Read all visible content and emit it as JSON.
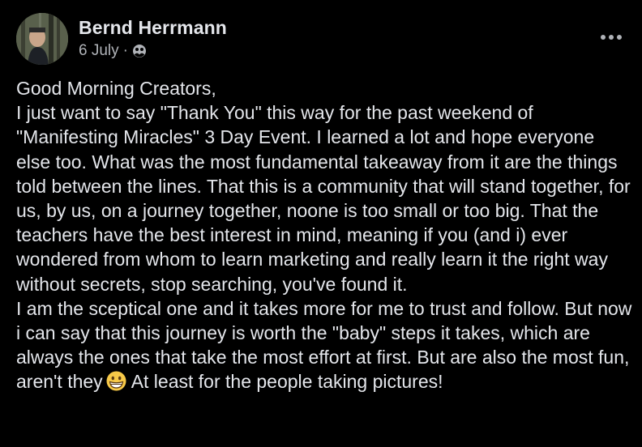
{
  "post": {
    "author_name": "Bernd Herrmann",
    "date": "6 July",
    "separator": "·",
    "privacy_icon": "friends-globe-icon",
    "more_icon": "ellipsis-icon",
    "body_before_emoji": "Good Morning Creators,\nI just want to say \"Thank You\" this way for the past weekend of \"Manifesting Miracles\" 3 Day Event. I learned a lot and hope everyone else too. What was the most fundamental takeaway from it are the things told between the lines. That this is a community that will stand together, for us, by us, on a journey together, noone is too small or too big. That the teachers have the best interest in mind, meaning if you (and i) ever wondered from whom to learn marketing and really learn it the right way without secrets, stop searching, you've found it.\nI am the sceptical one and it takes more for me to trust and follow. But now i can say that this journey is worth the \"baby\" steps it takes, which are always the ones that take the most effort at first. But are also the most fun, aren't they",
    "emoji": "grinning-face-emoji",
    "body_after_emoji": "At least for the people taking pictures!"
  },
  "colors": {
    "background": "#000000",
    "text_primary": "#e4e6eb",
    "text_secondary": "#b0b3b8",
    "emoji_yellow": "#f7c948"
  }
}
